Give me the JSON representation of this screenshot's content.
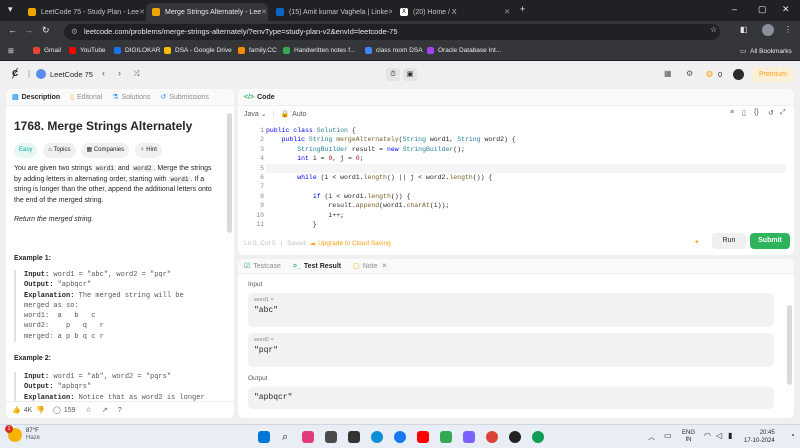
{
  "browser": {
    "tabs": [
      {
        "title": "LeetCode 75 - Study Plan - Lee",
        "favicon_color": "#f0a400"
      },
      {
        "title": "Merge Strings Alternately - Lee",
        "favicon_color": "#f0a400",
        "active": true
      },
      {
        "title": "(15) Amit kumar Vaghela | Linke",
        "favicon_color": "#0a66c2"
      },
      {
        "title": "(20) Home / X",
        "favicon_color": "#ffffff"
      }
    ],
    "new_tab": "+",
    "url": "leetcode.com/problems/merge-strings-alternately/?envType=study-plan-v2&envId=leetcode-75",
    "window_controls": [
      "–",
      "▢",
      "✕"
    ]
  },
  "bookmarks": {
    "items": [
      {
        "label": "Gmail",
        "color": "#ea4335"
      },
      {
        "label": "YouTube",
        "color": "#ff0000"
      },
      {
        "label": "DIGILOKAR",
        "color": "#1a73e8"
      },
      {
        "label": "DSA - Google Drive",
        "color": "#fbbc04"
      },
      {
        "label": "family.CC",
        "color": "#ff8c00"
      },
      {
        "label": "Handwritten notes f...",
        "color": "#34a853"
      },
      {
        "label": "class room DSA",
        "color": "#4285f4"
      },
      {
        "label": "Oracle Database Int...",
        "color": "#a142f4"
      }
    ],
    "all_bookmarks": "All Bookmarks"
  },
  "lcnav": {
    "study_plan": "LeetCode 75",
    "streak": "0",
    "premium": "Premium"
  },
  "left": {
    "tabs": [
      "Description",
      "Editorial",
      "Solutions",
      "Submissions"
    ],
    "title": "1768. Merge Strings Alternately",
    "chips": [
      "Easy",
      "Topics",
      "Companies",
      "Hint"
    ],
    "desc_a": "You are given two strings ",
    "code_word1": "word1",
    "desc_b": " and ",
    "code_word2": "word2",
    "desc_c": ". Merge the strings by adding letters in alternating order, starting with ",
    "desc_d": ". If a string is longer than the other, append the additional letters onto the end of the merged string.",
    "return_line": "Return the merged string.",
    "example1_title": "Example 1:",
    "example1_input_label": "Input:",
    "example1_input": " word1 = \"abc\", word2 = \"pqr\"",
    "example1_output_label": "Output:",
    "example1_output": " \"apbqcr\"",
    "example1_expl_label": "Explanation:",
    "example1_expl": " The merged string will be\nmerged as so:\nword1:  a   b   c\nword2:    p   q   r\nmerged: a p b q c r",
    "example2_title": "Example 2:",
    "example2_input_label": "Input:",
    "example2_input": " word1 = \"ab\", word2 = \"pqrs\"",
    "example2_output_label": "Output:",
    "example2_output": " \"apbqrs\"",
    "example2_expl_label": "Explanation:",
    "example2_expl": " Notice that as word2 is longer",
    "footer": {
      "likes": "4K",
      "comments": "159"
    }
  },
  "code": {
    "header": "Code",
    "language": "Java",
    "auto": "Auto",
    "line_numbers": [
      "1",
      "2",
      "3",
      "4",
      "5",
      "6",
      "7",
      "8",
      "9",
      "10",
      "11"
    ],
    "status": "Ln 5, Col 5",
    "saved": "Saved",
    "upgrade": "Upgrade to Cloud Saving",
    "run": "Run",
    "submit": "Submit"
  },
  "test": {
    "tabs": [
      "Testcase",
      "Test Result",
      "Note"
    ],
    "input_label": "Input",
    "word1_key": "word1 =",
    "word1_val": "\"abc\"",
    "word2_key": "word2 =",
    "word2_val": "\"pqr\"",
    "output_label": "Output",
    "output_val": "\"apbqcr\""
  },
  "taskbar": {
    "weather_temp": "87°F",
    "weather_desc": "Haze",
    "weather_badge": "1",
    "lang_top": "ENG",
    "lang_bottom": "IN",
    "time": "20:45",
    "date": "17-10-2024"
  }
}
